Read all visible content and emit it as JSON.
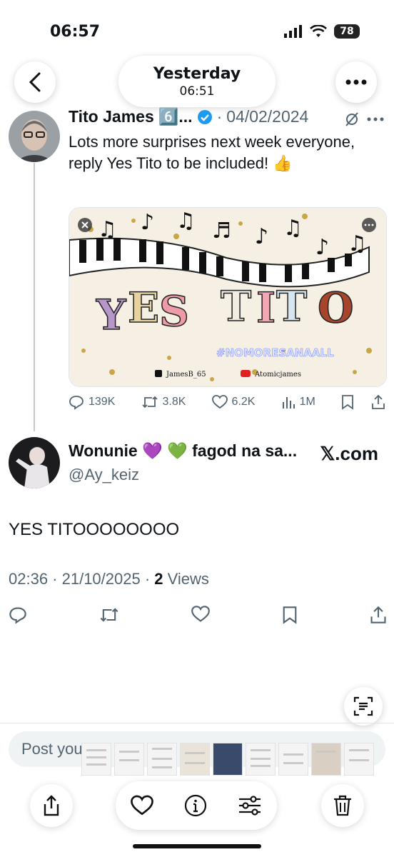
{
  "status_bar": {
    "time": "06:57",
    "battery": "78"
  },
  "header": {
    "date_line1": "Yesterday",
    "date_line2": "06:51"
  },
  "tweet1": {
    "name": "Tito James",
    "badge": "6️⃣...",
    "date": "04/02/2024",
    "text": "Lots more surprises next week everyone, reply Yes Tito to be included! 👍",
    "media": {
      "title": "YES TITO",
      "hashtag": "#NOMORESANAALL",
      "handle_x": "JamesB_65",
      "handle_yt": "Atomicjames"
    },
    "stats": {
      "replies": "139K",
      "reposts": "3.8K",
      "likes": "6.2K",
      "views": "1M"
    }
  },
  "tweet2": {
    "name": "Wonunie 💜 💚 fagod na sa...",
    "handle": "@Ay_keiz",
    "source": "𝕏.com",
    "text": "YES TITOOOOOOOO",
    "time_date": "02:36 · 21/10/2025 · ",
    "views_count": "2",
    "views_label": "Views"
  },
  "reply_bar": {
    "placeholder": "Post you"
  },
  "colors": {
    "verified": "#1d9bf0",
    "text": "#0f1419",
    "muted": "#536471"
  }
}
